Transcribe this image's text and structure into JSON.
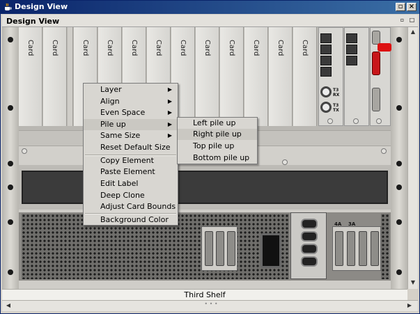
{
  "window": {
    "title": "Design View",
    "restore_glyph": "▫",
    "close_glyph": "×"
  },
  "panel": {
    "title": "Design View",
    "float_glyph": "▫",
    "max_glyph": "□"
  },
  "cards": {
    "label": "Card"
  },
  "io": {
    "t3_rx": "T3 RX",
    "t3_tx": "T3 TX",
    "slot_4a": "4A",
    "slot_3a": "3A"
  },
  "context_menu": {
    "items": [
      {
        "label": "Layer",
        "has_submenu": true
      },
      {
        "label": "Align",
        "has_submenu": true
      },
      {
        "label": "Even Space",
        "has_submenu": true
      },
      {
        "label": "Pile up",
        "has_submenu": true
      },
      {
        "label": "Same Size",
        "has_submenu": true
      },
      {
        "label": "Reset Default Size",
        "has_submenu": false
      },
      {
        "label": "Copy Element",
        "has_submenu": false
      },
      {
        "label": "Paste Element",
        "has_submenu": false
      },
      {
        "label": "Edit Label",
        "has_submenu": false
      },
      {
        "label": "Deep Clone",
        "has_submenu": false
      },
      {
        "label": "Adjust Card Bounds",
        "has_submenu": false
      },
      {
        "label": "Background Color",
        "has_submenu": false
      }
    ],
    "submenu_arrow": "▶"
  },
  "submenu": {
    "items": [
      {
        "label": "Left pile up"
      },
      {
        "label": "Right pile up"
      },
      {
        "label": "Top pile up"
      },
      {
        "label": "Bottom pile up"
      }
    ]
  },
  "status": {
    "shelf_label": "Third Shelf",
    "grip": "• • •"
  },
  "scroll": {
    "up": "▲",
    "down": "▼",
    "left": "◀",
    "right": "▶"
  },
  "colors": {
    "titlebar": "#0a246a",
    "menu_bg": "#d8d6d1",
    "alarm_red": "#c8161a"
  }
}
